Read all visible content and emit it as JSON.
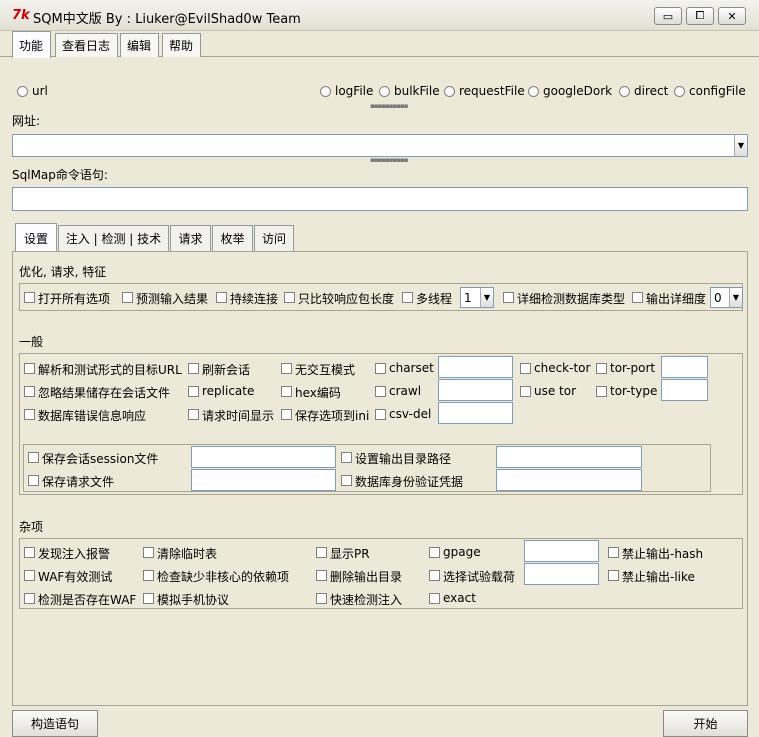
{
  "window": {
    "title": "SQM中文版 By : Liuker@EvilShad0w Team",
    "icon_glyph": "7k",
    "minimize_glyph": "▭",
    "restore_glyph": "⧠",
    "close_glyph": "✕"
  },
  "menu": [
    "功能",
    "查看日志",
    "编辑",
    "帮助"
  ],
  "sources": [
    "url",
    "logFile",
    "bulkFile",
    "requestFile",
    "googleDork",
    "direct",
    "configFile"
  ],
  "address_label": "网址:",
  "address_value": "",
  "cmd_label": "SqlMap命令语句:",
  "cmd_value": "",
  "inner_tabs": [
    "设置",
    "注入 | 检测 | 技术",
    "请求",
    "枚举",
    "访问"
  ],
  "opt": {
    "title": "优化, 请求, 特征",
    "all_options": "打开所有选项",
    "predict": "预测输入结果",
    "keep_alive": "持续连接",
    "null_conn": "只比较响应包长度",
    "threads": "多线程",
    "threads_value": "1",
    "detail_dbms": "详细检测数据库类型",
    "verbose": "输出详细度",
    "verbose_value": "0"
  },
  "general": {
    "title": "一般",
    "c1": [
      "解析和测试形式的目标URL",
      "忽略结果储存在会话文件",
      "数据库错误信息响应"
    ],
    "c2": [
      "刷新会话",
      "replicate",
      "请求时间显示"
    ],
    "c3": [
      "无交互模式",
      "hex编码",
      "保存选项到ini"
    ],
    "c4": [
      "charset",
      "crawl",
      "csv-del"
    ],
    "c5": [
      "check-tor",
      "use tor"
    ],
    "c6": [
      "tor-port",
      "tor-type"
    ],
    "save_session": "保存会话session文件",
    "save_request": "保存请求文件",
    "output_dir": "设置输出目录路径",
    "db_auth": "数据库身份验证凭据"
  },
  "misc": {
    "title": "杂项",
    "c1": [
      "发现注入报警",
      "WAF有效测试",
      "检测是否存在WAF"
    ],
    "c2": [
      "清除临时表",
      "检查缺少非核心的依赖项",
      "模拟手机协议"
    ],
    "c3": [
      "显示PR",
      "删除输出目录",
      "快速检测注入"
    ],
    "c4": [
      "gpage",
      "选择试验载荷",
      "exact"
    ],
    "c5": [
      "禁止输出-hash",
      "禁止输出-like"
    ]
  },
  "buttons": {
    "build": "构造语句",
    "start": "开始"
  }
}
